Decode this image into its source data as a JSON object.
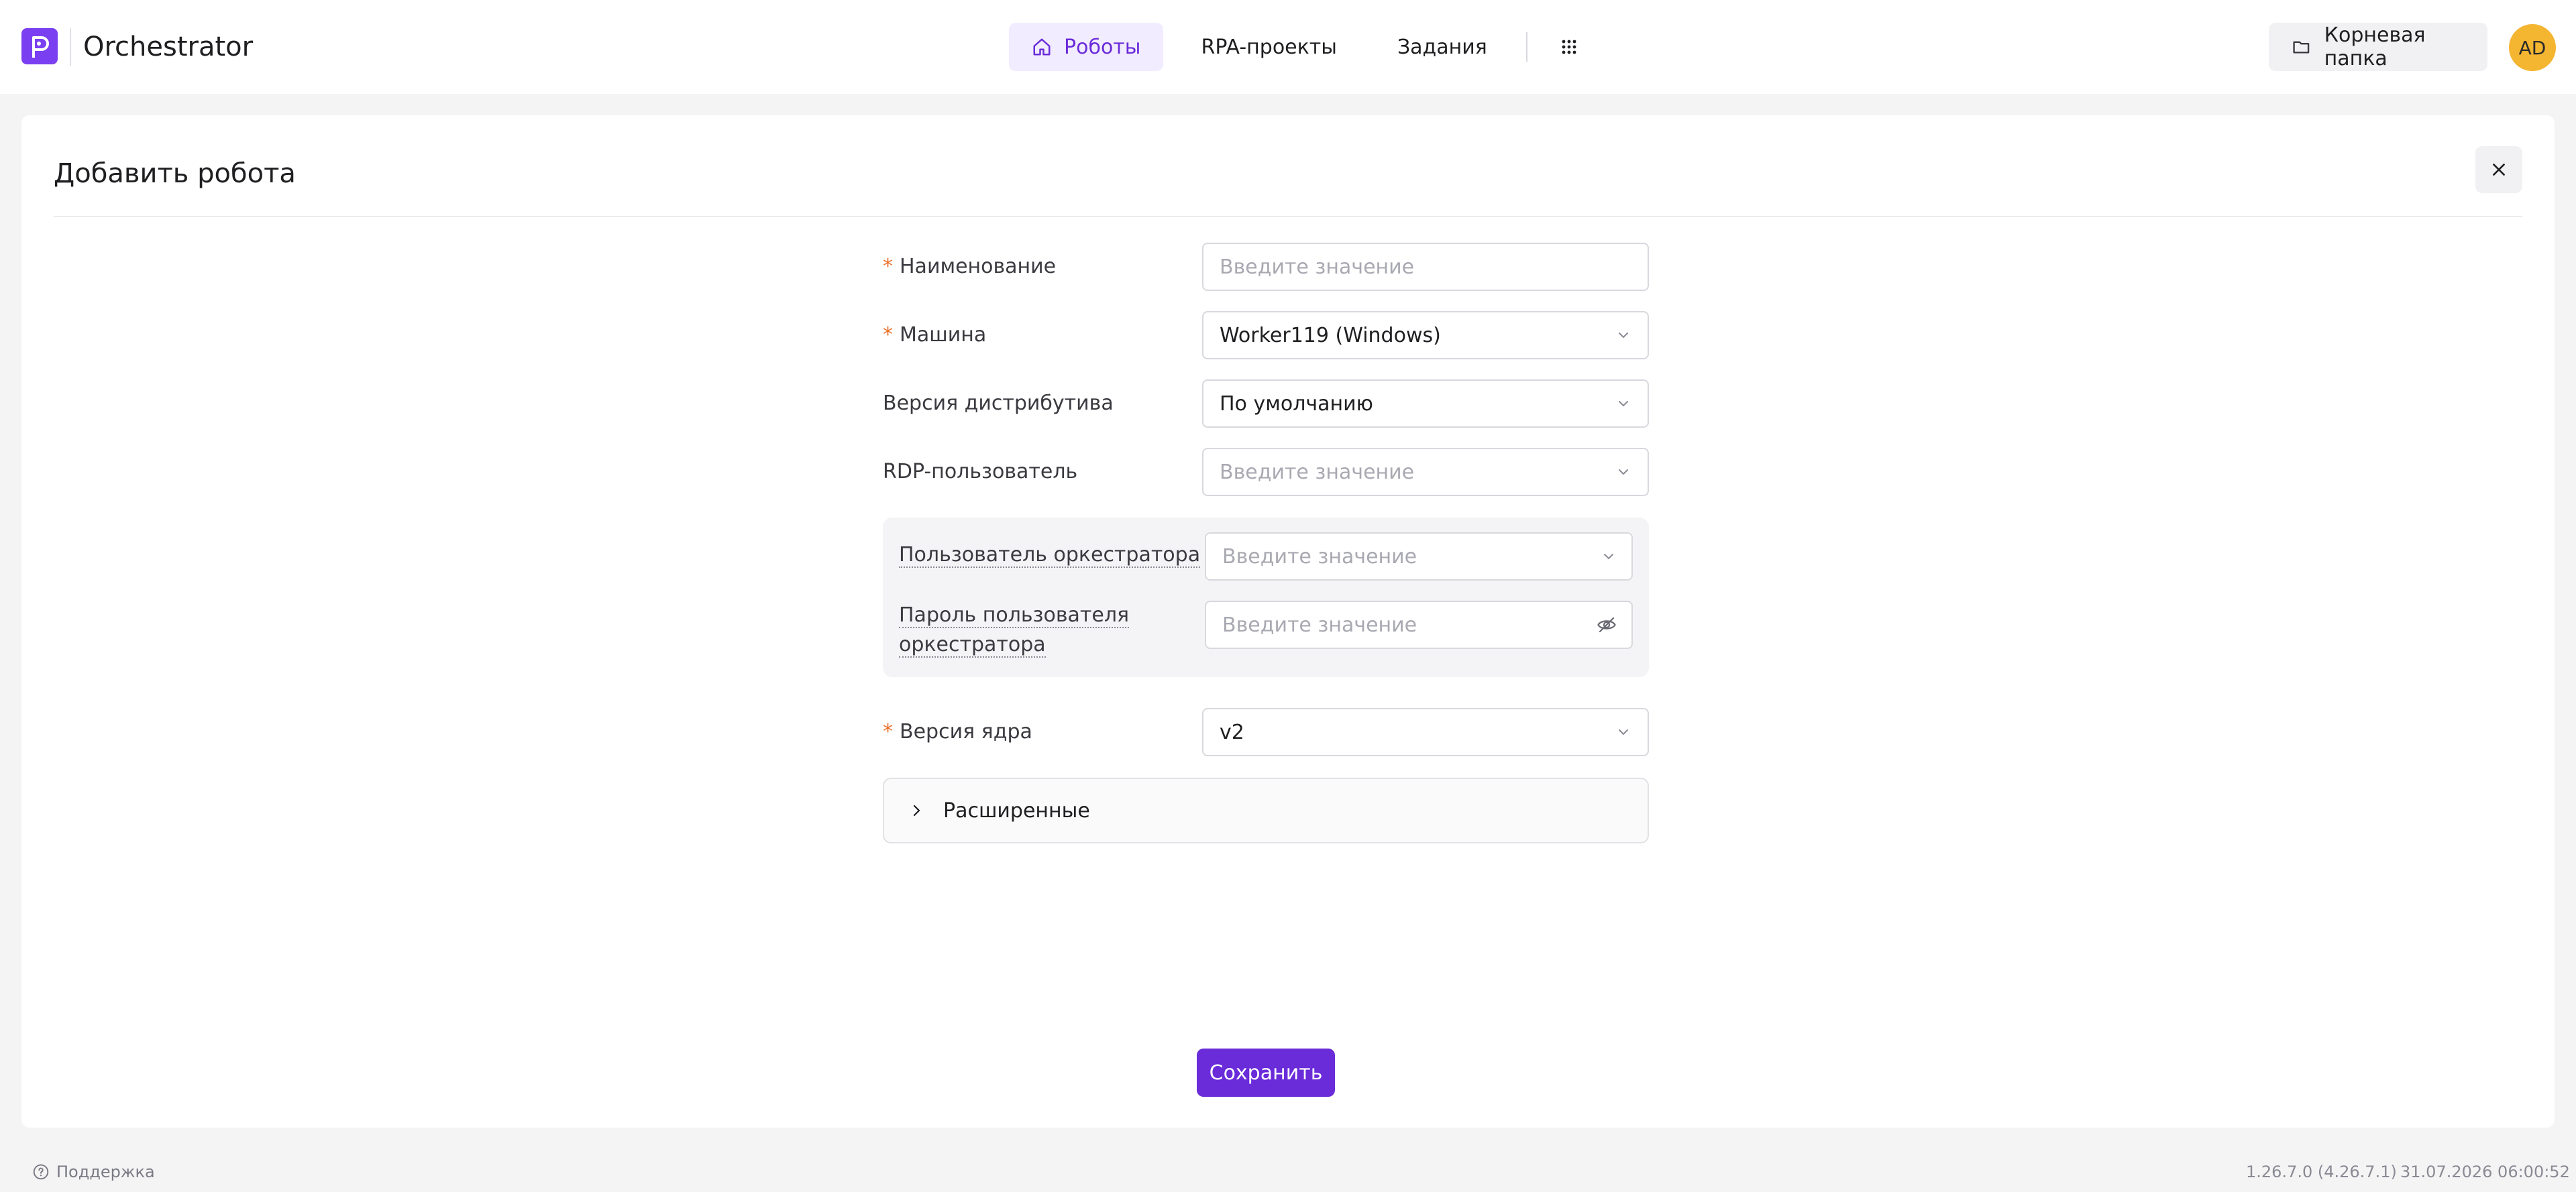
{
  "header": {
    "app_title": "Orchestrator",
    "nav": [
      {
        "label": "Роботы",
        "icon": "home-icon",
        "active": true
      },
      {
        "label": "RPA-проекты",
        "active": false
      },
      {
        "label": "Задания",
        "active": false
      }
    ],
    "root_folder_label": "Корневая папка",
    "avatar_initials": "AD"
  },
  "panel": {
    "title": "Добавить робота",
    "fields": {
      "name": {
        "label": "Наименование",
        "required": true,
        "placeholder": "Введите значение",
        "value": ""
      },
      "machine": {
        "label": "Машина",
        "required": true,
        "value": "Worker119 (Windows)"
      },
      "distrib_version": {
        "label": "Версия дистрибутива",
        "required": false,
        "value": "По умолчанию"
      },
      "rdp_user": {
        "label": "RDP-пользователь",
        "required": false,
        "placeholder": "Введите значение",
        "value": ""
      },
      "orch_user": {
        "label": "Пользователь оркестратора",
        "placeholder": "Введите значение",
        "value": ""
      },
      "orch_password": {
        "label_line1": "Пароль пользователя",
        "label_line2": "оркестратора",
        "placeholder": "Введите значение",
        "value": ""
      },
      "core_version": {
        "label": "Версия ядра",
        "required": true,
        "value": "v2"
      }
    },
    "advanced_label": "Расширенные",
    "save_label": "Сохранить"
  },
  "footer": {
    "support_label": "Поддержка",
    "version": "1.26.7.0 (4.26.7.1)",
    "datetime": "31.07.2026 06:00:52"
  },
  "colors": {
    "accent": "#6a2bd9",
    "logo": "#7b3ff2",
    "required_marker": "#e8702a",
    "avatar": "#f4b531"
  }
}
